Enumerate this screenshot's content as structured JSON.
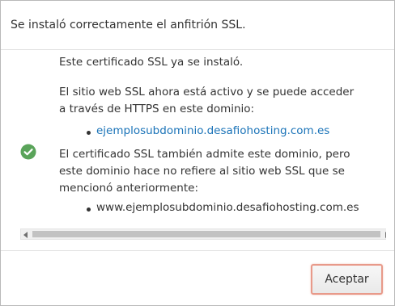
{
  "dialog": {
    "title": "Se instaló correctamente el anfitrión SSL.",
    "body": {
      "line1": "Este certificado SSL ya se instaló.",
      "line2a": "El sitio web SSL ahora está activo y se puede acceder",
      "line2b": "a través de HTTPS en este dominio:",
      "active_domain": "ejemplosubdominio.desafiohosting.com.es",
      "line3a": "El certificado SSL también admite este dominio, pero",
      "line3b": "este dominio hace no refiere al sitio web SSL que se",
      "line3c": "mencionó anteriormente:",
      "other_domain": "www.ejemplosubdominio.desafiohosting.com.es"
    },
    "accept_label": "Aceptar",
    "icons": {
      "success": "check-circle-icon",
      "scroll_left": "arrow-left-icon",
      "scroll_right": "arrow-right-icon"
    },
    "colors": {
      "success": "#5aa45a",
      "link": "#1a73b8",
      "button_focus": "#e89a8a"
    }
  }
}
